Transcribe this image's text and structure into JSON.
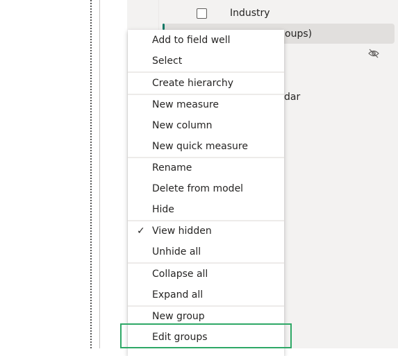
{
  "background_fields": {
    "industry_label": "Industry",
    "highlighted_fragment": "oups)",
    "calendar_fragment": "dar",
    "hidden_icon": "eye-slash-icon",
    "accent_color": "#117865"
  },
  "context_menu": {
    "items": [
      {
        "label": "Add to field well"
      },
      {
        "label": "Select"
      },
      {
        "label": "Create hierarchy"
      },
      {
        "label": "New measure"
      },
      {
        "label": "New column"
      },
      {
        "label": "New quick measure"
      },
      {
        "label": "Rename"
      },
      {
        "label": "Delete from model"
      },
      {
        "label": "Hide"
      },
      {
        "label": "View hidden",
        "checked": true
      },
      {
        "label": "Unhide all"
      },
      {
        "label": "Collapse all"
      },
      {
        "label": "Expand all"
      },
      {
        "label": "New group"
      },
      {
        "label": "Edit groups",
        "highlighted": true
      }
    ],
    "highlight_color": "#2ea866"
  }
}
